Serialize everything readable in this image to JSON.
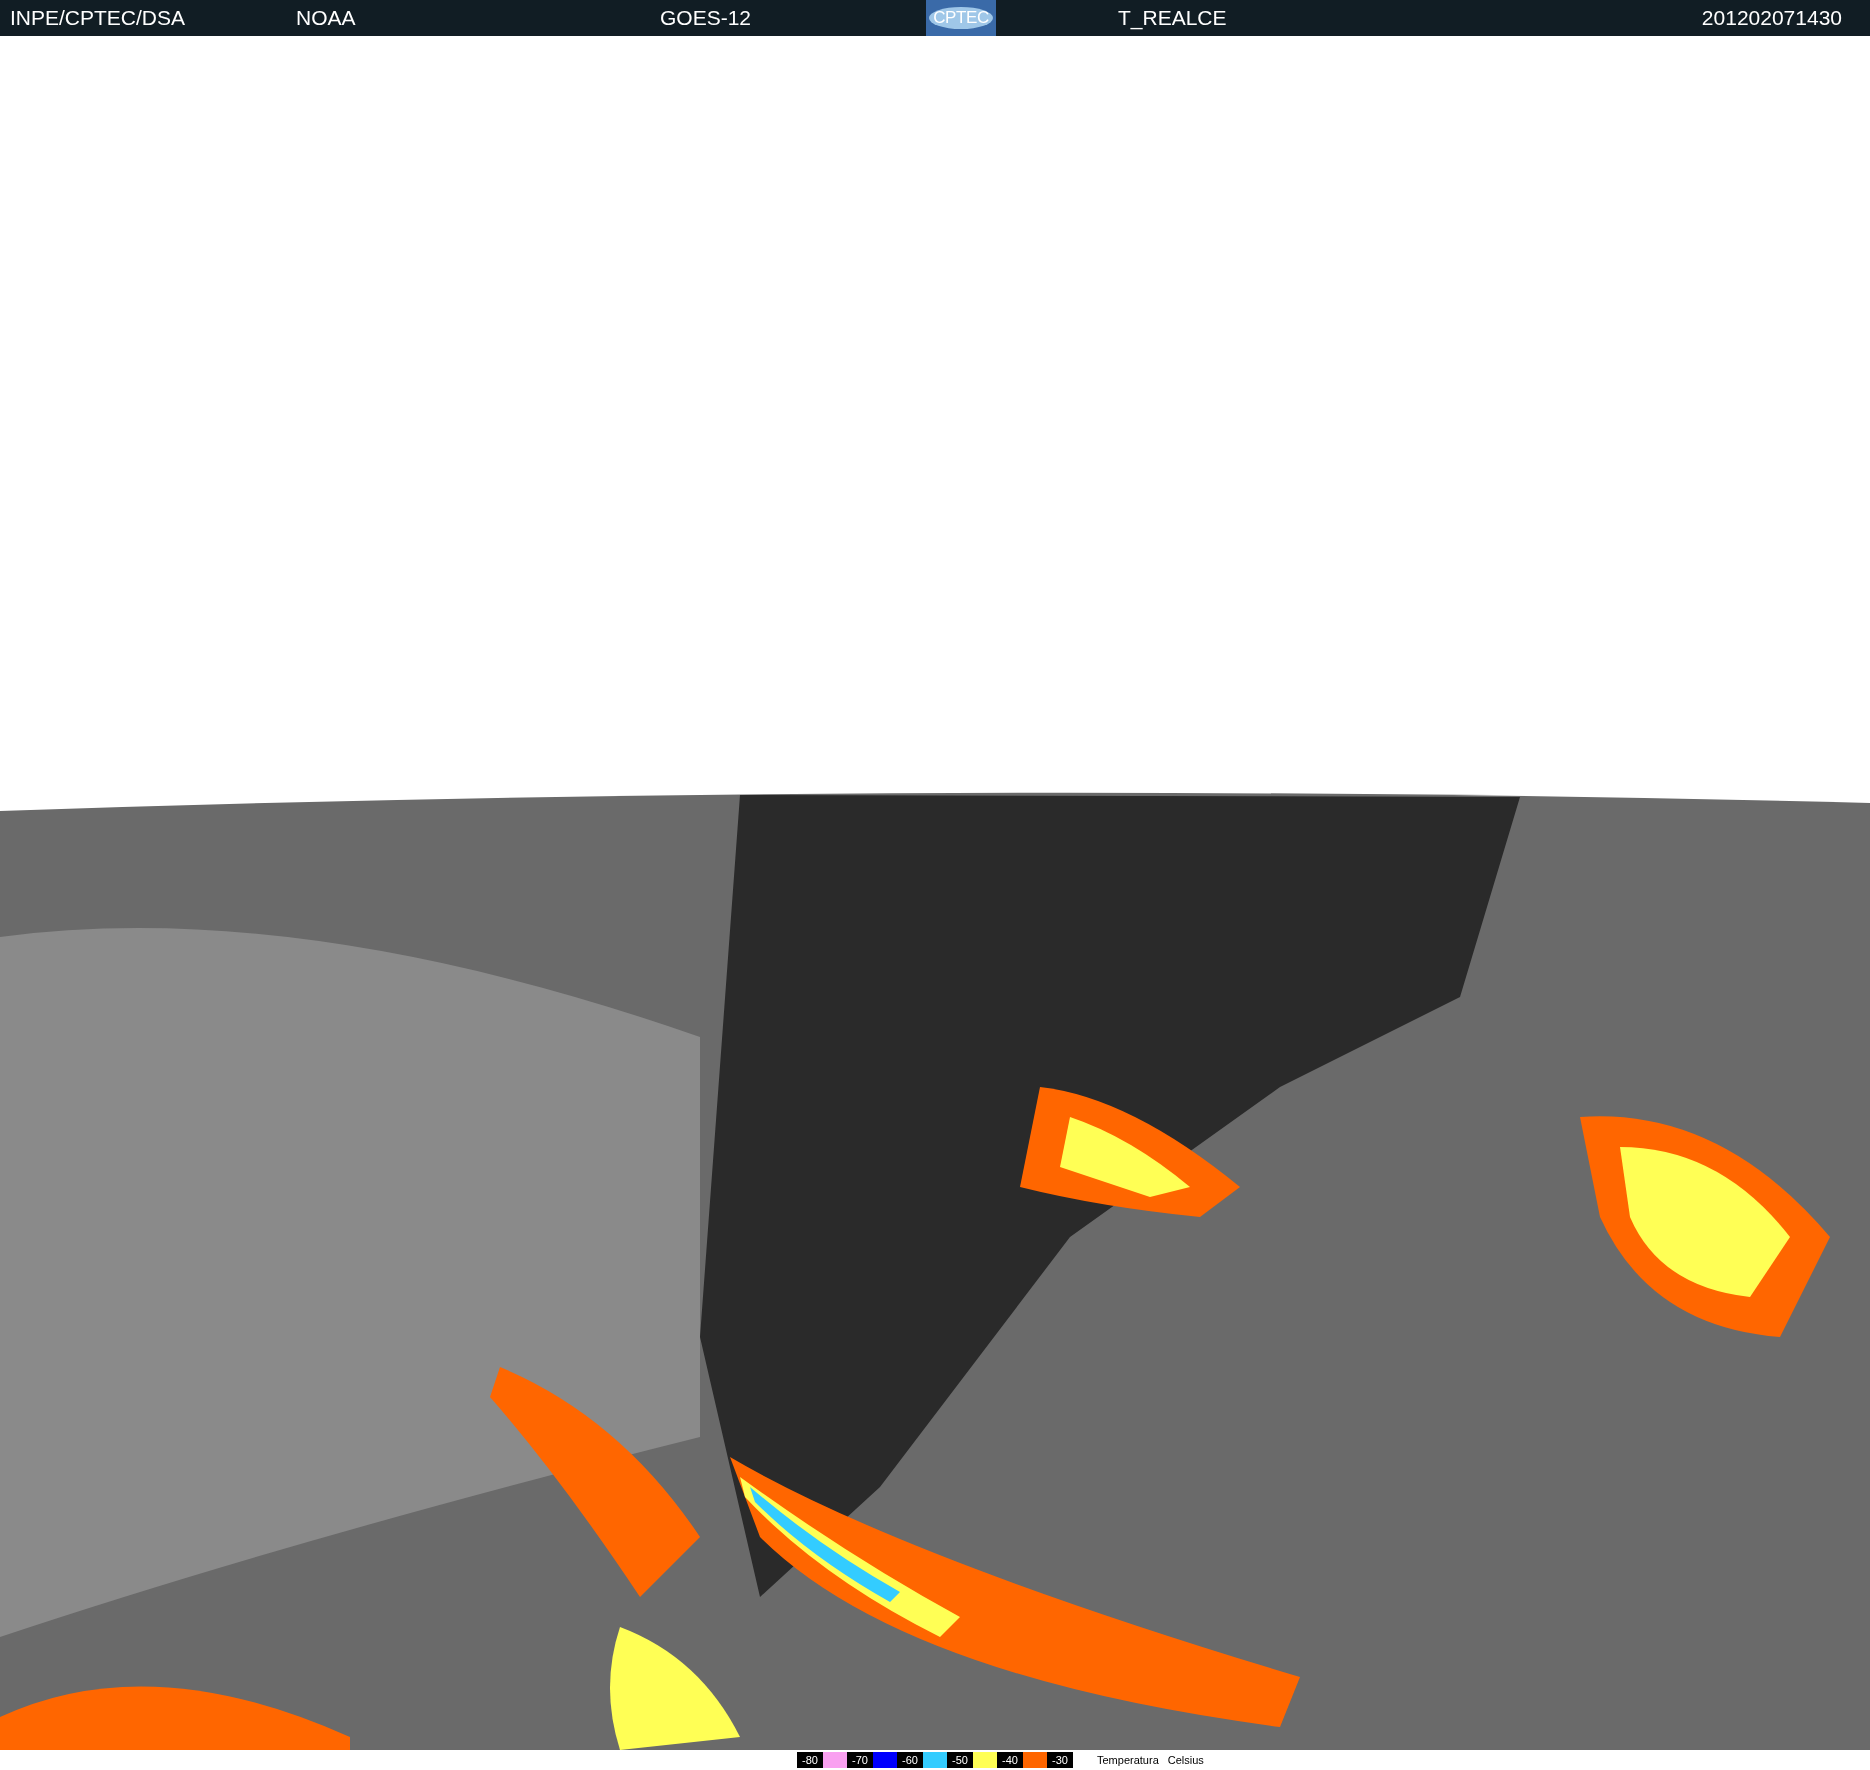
{
  "header": {
    "items": [
      "INPE/CPTEC/DSA",
      "NOAA",
      "GOES-12"
    ],
    "logo_text": "CPTEC",
    "product": "T_REALCE",
    "timestamp": "201202071430"
  },
  "legend": {
    "steps": [
      {
        "label": "-80",
        "color": "#f9a0f0"
      },
      {
        "label": "-70",
        "color": "#0000ff"
      },
      {
        "label": "-60",
        "color": "#33ccff"
      },
      {
        "label": "-50",
        "color": "#ffff55"
      },
      {
        "label": "-40",
        "color": "#ff6600"
      },
      {
        "label": "-30"
      }
    ],
    "title": [
      "Temperatura",
      "Celsius"
    ]
  }
}
